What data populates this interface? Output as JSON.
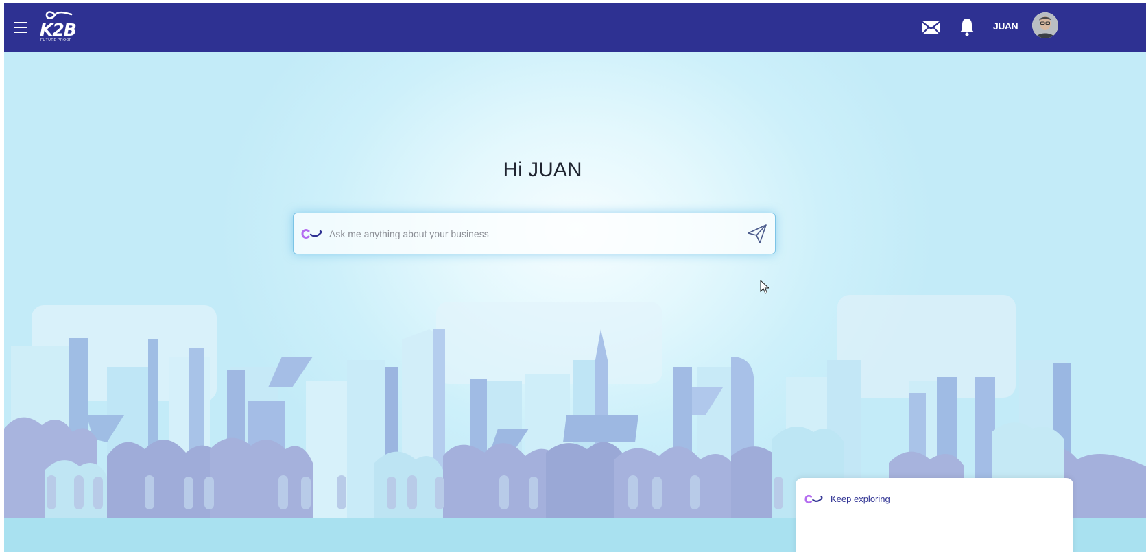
{
  "app": {
    "brand": "K2B",
    "brand_tagline": "FUTURE PROOF",
    "colors": {
      "header_bg": "#2e3192",
      "accent_purple": "#a855f7",
      "accent_blue": "#2e3192",
      "chat_border": "#7cc4e6"
    }
  },
  "header": {
    "menu_icon": "hamburger-menu-icon",
    "mail_icon": "mail-icon",
    "notification_icon": "bell-icon",
    "username": "JUAN",
    "avatar_icon": "user-avatar"
  },
  "main": {
    "greeting": "Hi JUAN",
    "chat": {
      "placeholder": "Ask me anything about your business",
      "value": "",
      "send_icon": "send-icon",
      "logo_icon": "k2b-ai-logo-icon"
    }
  },
  "explore": {
    "label": "Keep exploring",
    "logo_icon": "k2b-ai-logo-icon"
  }
}
